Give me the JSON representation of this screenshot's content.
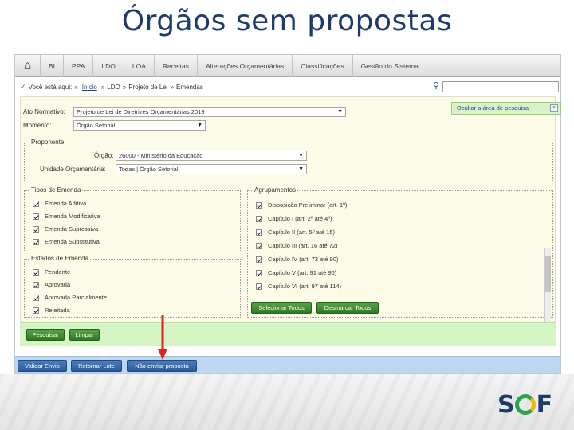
{
  "slide": {
    "title": "Órgãos sem propostas",
    "logo": {
      "left": "S",
      "right": "F"
    }
  },
  "menu": [
    "BI",
    "PPA",
    "LDO",
    "LOA",
    "Receitas",
    "Alterações Orçamentárias",
    "Classificações",
    "Gestão do Sistema"
  ],
  "breadcrumb": {
    "prefix": "Você está aqui:",
    "items": [
      "Início",
      "LDO",
      "Projeto de Lei",
      "Emendas"
    ]
  },
  "filters": {
    "ato_label": "Ato Normativo:",
    "ato_value": "Projeto de Lei de Diretrizes Orçamentárias 2019",
    "momento_label": "Momento:",
    "momento_value": "Órgão Setorial",
    "hide_link": "Ocultar a área de pesquisa",
    "proponente": {
      "legend": "Proponente",
      "orgao_label": "Órgão:",
      "orgao_value": "26000 - Ministério da Educação",
      "uo_label": "Unidade Orçamentária:",
      "uo_value": "Todas | Órgão Setorial"
    },
    "tipos": {
      "legend": "Tipos de Emenda",
      "items": [
        "Emenda Aditiva",
        "Emenda Modificativa",
        "Emenda Supressiva",
        "Emenda Substitutiva"
      ]
    },
    "estados": {
      "legend": "Estados de Emenda",
      "items": [
        "Pendente",
        "Aprovada",
        "Aprovada Parcialmente",
        "Rejeitada"
      ]
    },
    "agrupamentos": {
      "legend": "Agrupamentos",
      "items": [
        "Disposição Preliminar (art. 1º)",
        "Capítulo I (art. 2º até 4º)",
        "Capítulo II (art. 5º até 15)",
        "Capítulo III (art. 16 até 72)",
        "Capítulo IV (art. 73 até 90)",
        "Capítulo V (art. 91 até 96)",
        "Capítulo VI (art. 97 até 114)"
      ],
      "select_all": "Selecionar Todos",
      "deselect_all": "Desmarcar Todos"
    }
  },
  "actions": {
    "search": "Pesquisar",
    "clear": "Limpar"
  },
  "footer": {
    "validate": "Validar Envio",
    "return": "Retornar Lote",
    "no_proposal": "Não enviar proposta"
  },
  "colors": {
    "title": "#1f3b6e",
    "green_button": "#2e7a24",
    "blue_button": "#2a5a98",
    "arrow": "#e0211a"
  }
}
